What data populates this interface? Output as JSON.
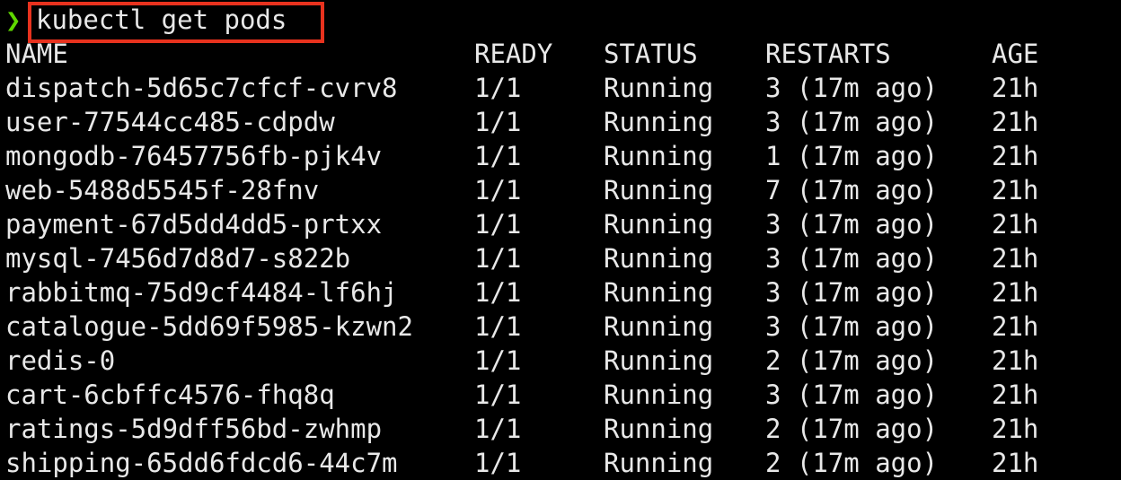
{
  "prompt": {
    "symbol": "❯",
    "command": "kubectl get pods"
  },
  "colors": {
    "background": "#000000",
    "text": "#e8e8e8",
    "prompt": "#5fd700",
    "highlight_box": "#e8321e"
  },
  "table": {
    "headers": [
      "NAME",
      "READY",
      "STATUS",
      "RESTARTS",
      "AGE"
    ],
    "rows": [
      [
        "dispatch-5d65c7cfcf-cvrv8",
        "1/1",
        "Running",
        "3 (17m ago)",
        "21h"
      ],
      [
        "user-77544cc485-cdpdw",
        "1/1",
        "Running",
        "3 (17m ago)",
        "21h"
      ],
      [
        "mongodb-76457756fb-pjk4v",
        "1/1",
        "Running",
        "1 (17m ago)",
        "21h"
      ],
      [
        "web-5488d5545f-28fnv",
        "1/1",
        "Running",
        "7 (17m ago)",
        "21h"
      ],
      [
        "payment-67d5dd4dd5-prtxx",
        "1/1",
        "Running",
        "3 (17m ago)",
        "21h"
      ],
      [
        "mysql-7456d7d8d7-s822b",
        "1/1",
        "Running",
        "3 (17m ago)",
        "21h"
      ],
      [
        "rabbitmq-75d9cf4484-lf6hj",
        "1/1",
        "Running",
        "3 (17m ago)",
        "21h"
      ],
      [
        "catalogue-5dd69f5985-kzwn2",
        "1/1",
        "Running",
        "3 (17m ago)",
        "21h"
      ],
      [
        "redis-0",
        "1/1",
        "Running",
        "2 (17m ago)",
        "21h"
      ],
      [
        "cart-6cbffc4576-fhq8q",
        "1/1",
        "Running",
        "3 (17m ago)",
        "21h"
      ],
      [
        "ratings-5d9dff56bd-zwhmp",
        "1/1",
        "Running",
        "2 (17m ago)",
        "21h"
      ],
      [
        "shipping-65dd6fdcd6-44c7m",
        "1/1",
        "Running",
        "2 (17m ago)",
        "21h"
      ]
    ]
  }
}
